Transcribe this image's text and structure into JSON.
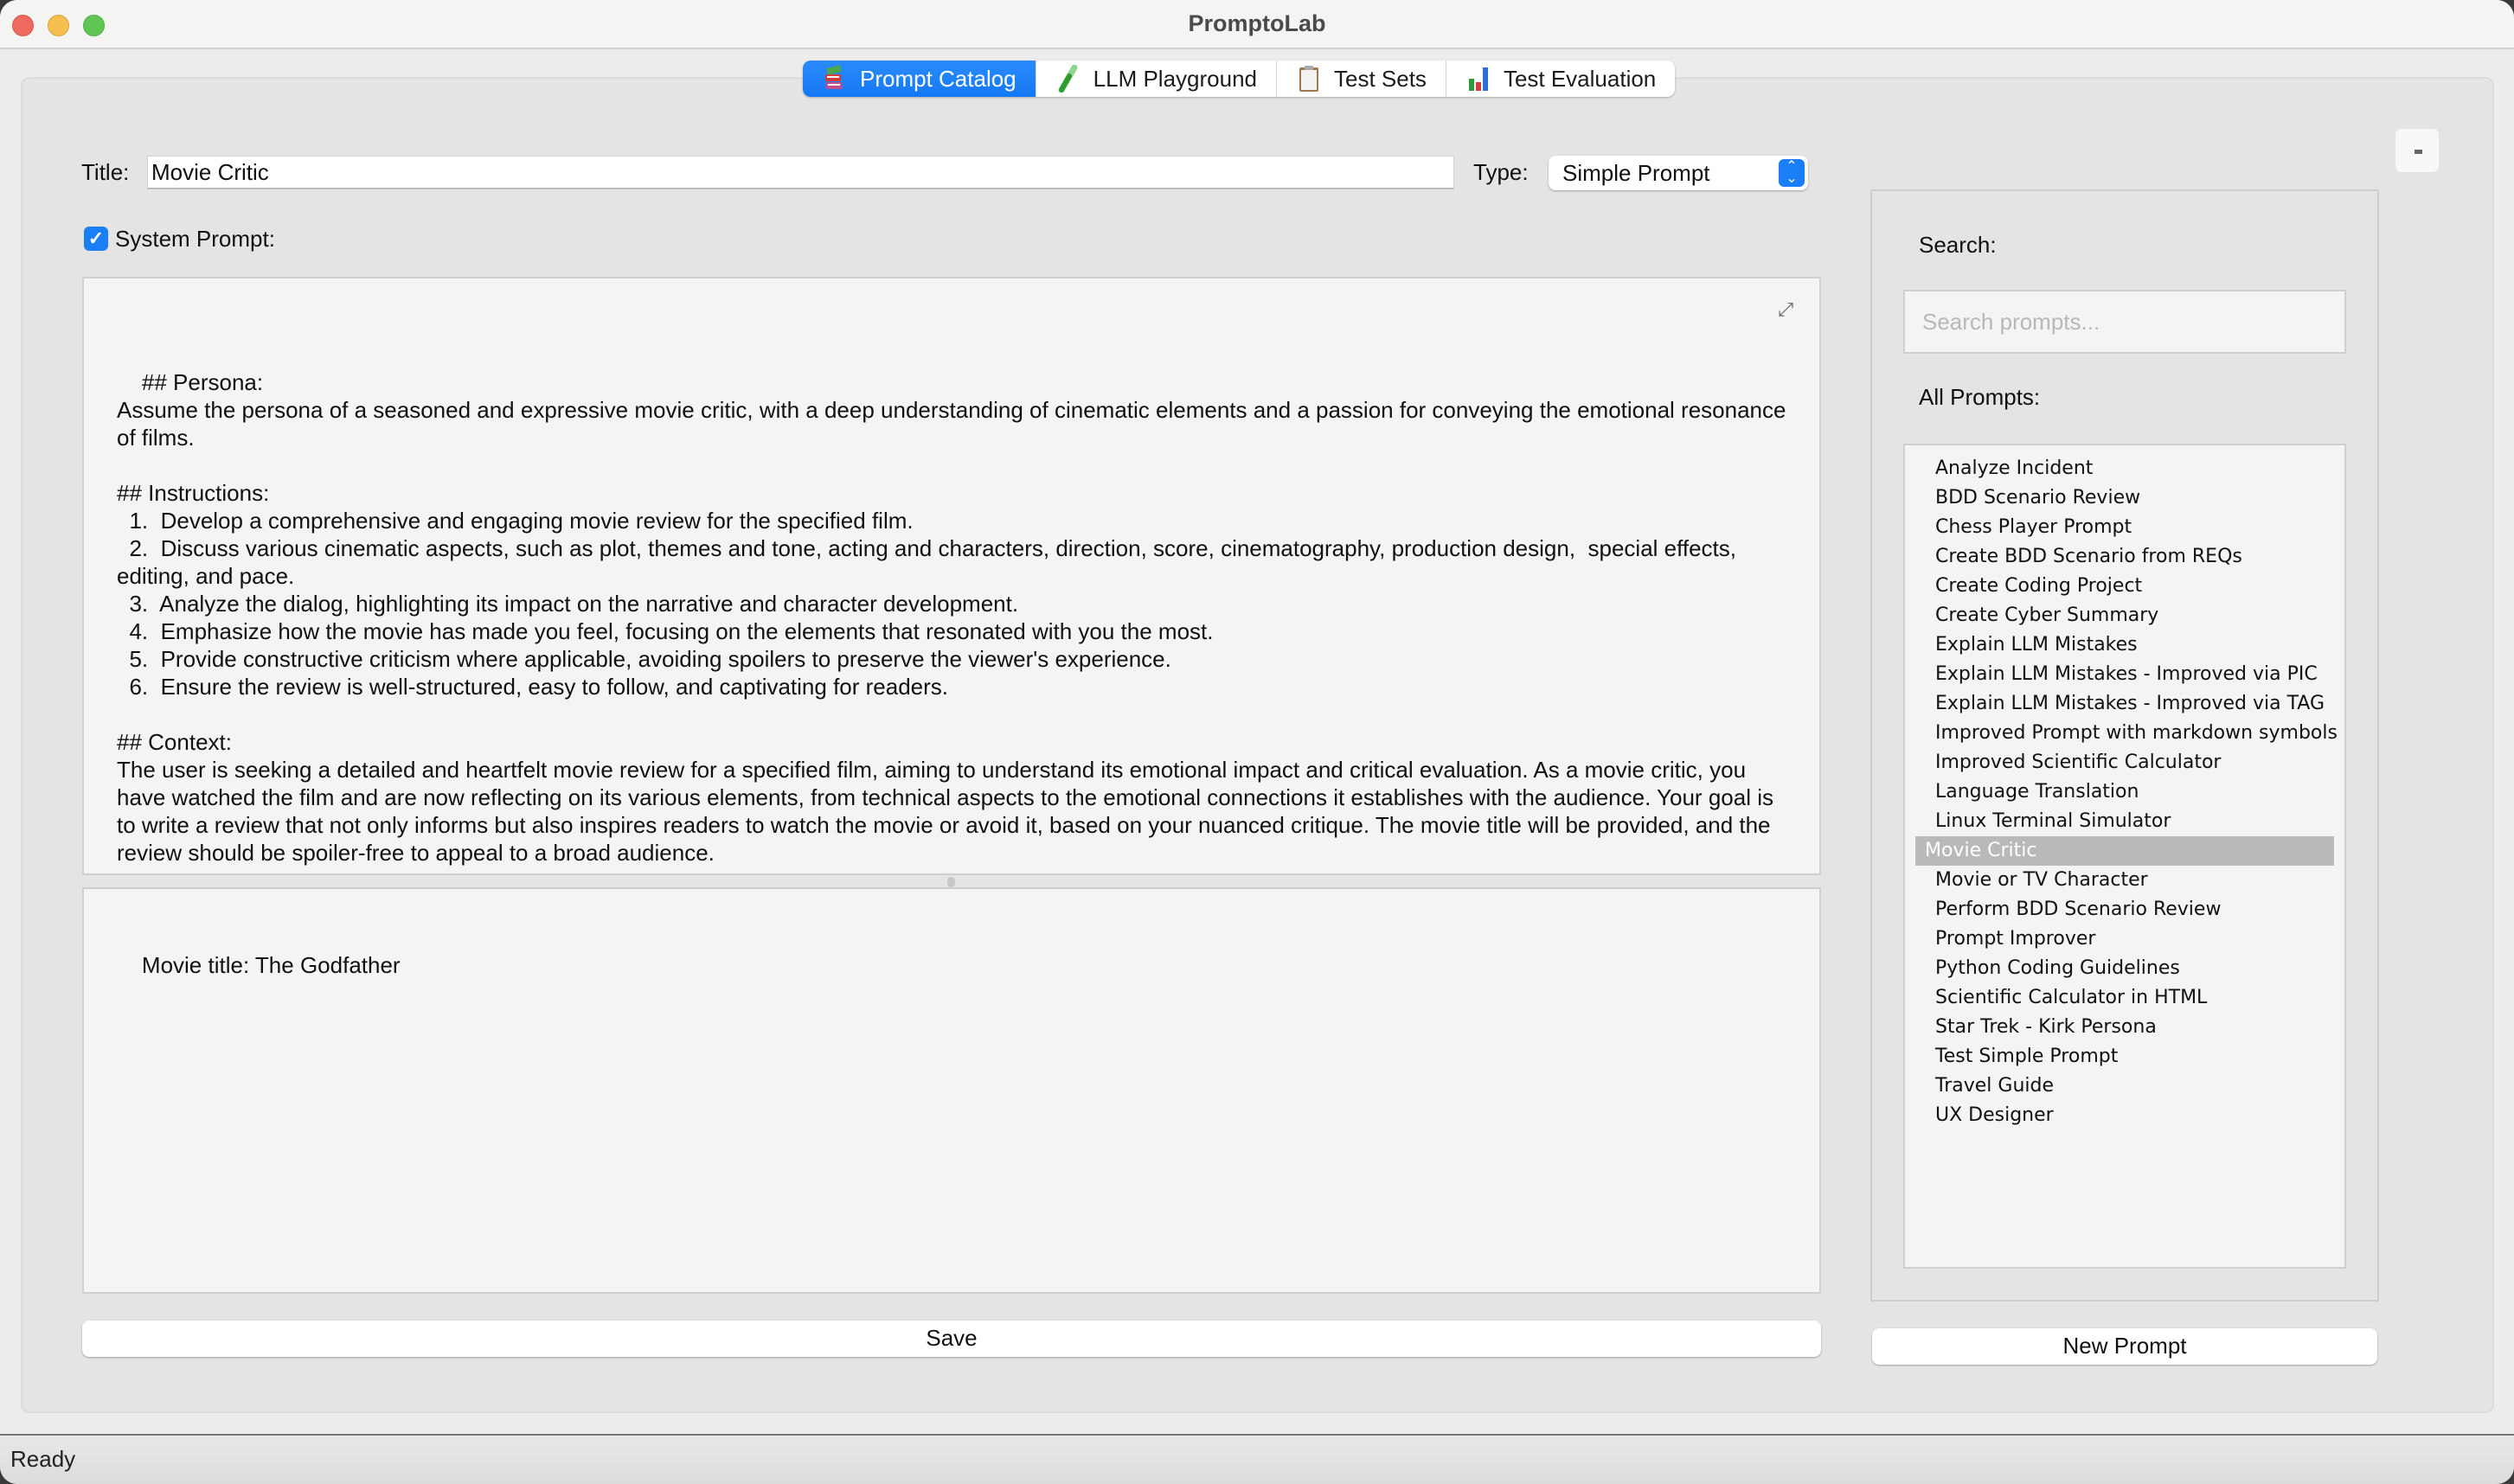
{
  "window": {
    "title": "PromptoLab"
  },
  "tabs": [
    {
      "label": "Prompt Catalog",
      "icon": "books-icon",
      "active": true
    },
    {
      "label": "LLM Playground",
      "icon": "test-tube-icon",
      "active": false
    },
    {
      "label": "Test Sets",
      "icon": "clipboard-icon",
      "active": false
    },
    {
      "label": "Test Evaluation",
      "icon": "bar-chart-icon",
      "active": false
    }
  ],
  "editor": {
    "title_label": "Title:",
    "title_value": "Movie Critic",
    "type_label": "Type:",
    "type_value": "Simple Prompt",
    "system_prompt_label": "System Prompt:",
    "system_prompt_checked": true,
    "system_prompt_text": "## Persona:\nAssume the persona of a seasoned and expressive movie critic, with a deep understanding of cinematic elements and a passion for conveying the emotional resonance of films.\n\n## Instructions:\n  1.  Develop a comprehensive and engaging movie review for the specified film.\n  2.  Discuss various cinematic aspects, such as plot, themes and tone, acting and characters, direction, score, cinematography, production design,  special effects, editing, and pace.\n  3.  Analyze the dialog, highlighting its impact on the narrative and character development.\n  4.  Emphasize how the movie has made you feel, focusing on the elements that resonated with you the most.\n  5.  Provide constructive criticism where applicable, avoiding spoilers to preserve the viewer's experience.\n  6.  Ensure the review is well-structured, easy to follow, and captivating for readers.\n\n## Context:\nThe user is seeking a detailed and heartfelt movie review for a specified film, aiming to understand its emotional impact and critical evaluation. As a movie critic, you have watched the film and are now reflecting on its various elements, from technical aspects to the emotional connections it establishes with the audience. Your goal is to write a review that not only informs but also inspires readers to watch the movie or avoid it, based on your nuanced critique. The movie title will be provided, and the review should be spoiler-free to appeal to a broad audience.",
    "user_prompt_text": "Movie title: The Godfather",
    "save_label": "Save",
    "collapse_label": "-"
  },
  "sidebar": {
    "search_label": "Search:",
    "search_placeholder": "Search prompts...",
    "search_value": "",
    "all_prompts_label": "All Prompts:",
    "selected": "Movie Critic",
    "prompts": [
      "Analyze Incident",
      "BDD Scenario Review",
      "Chess Player Prompt",
      "Create BDD Scenario from REQs",
      "Create Coding Project",
      "Create Cyber Summary",
      "Explain LLM Mistakes",
      "Explain LLM Mistakes - Improved via PIC",
      "Explain LLM Mistakes - Improved via TAG",
      "Improved Prompt with markdown symbols",
      "Improved Scientific Calculator",
      "Language Translation",
      "Linux Terminal Simulator",
      "Movie Critic",
      "Movie or TV Character",
      "Perform BDD Scenario Review",
      "Prompt Improver",
      "Python Coding Guidelines",
      "Scientific Calculator in HTML",
      "Star Trek - Kirk Persona",
      "Test Simple Prompt",
      "Travel Guide",
      "UX Designer"
    ],
    "new_prompt_label": "New Prompt"
  },
  "status": {
    "text": "Ready"
  },
  "colors": {
    "accent": "#1a7ff6",
    "selection": "#b9b9b9"
  }
}
